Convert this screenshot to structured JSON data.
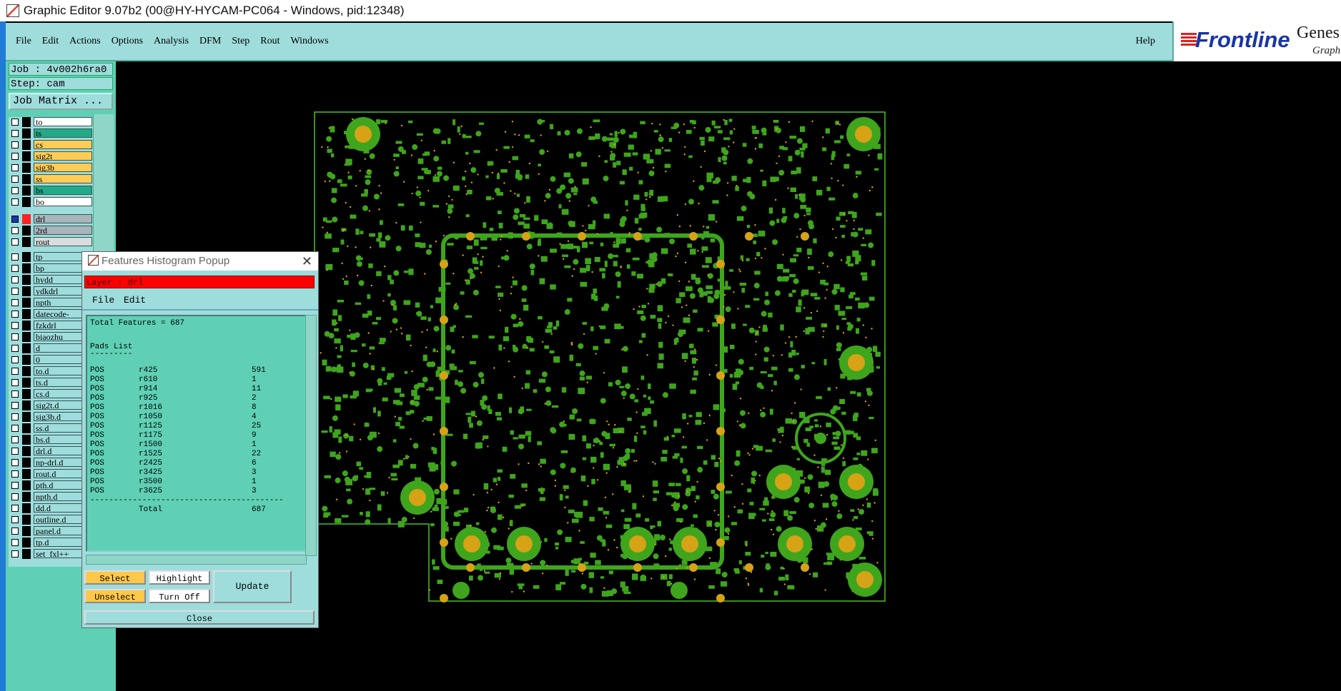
{
  "window": {
    "title": "Graphic Editor 9.07b2 (00@HY-HYCAM-PC064 - Windows, pid:12348)"
  },
  "menubar": {
    "items": [
      "File",
      "Edit",
      "Actions",
      "Options",
      "Analysis",
      "DFM",
      "Step",
      "Rout",
      "Windows"
    ],
    "help": "Help"
  },
  "logo": {
    "brand": "Frontline",
    "product": "Genes",
    "sub": "Graphi"
  },
  "side": {
    "job": "Job : 4v002h6ra0",
    "step": "Step: cam",
    "job_matrix": "Job Matrix ...",
    "layers": [
      {
        "name": "to",
        "color": "#ffffff"
      },
      {
        "name": "ts",
        "color": "#22aa88"
      },
      {
        "name": "cs",
        "color": "#ffcc55"
      },
      {
        "name": "sig2t",
        "color": "#ffcc55"
      },
      {
        "name": "sig3b",
        "color": "#ffcc55"
      },
      {
        "name": "ss",
        "color": "#ffcc55"
      },
      {
        "name": "bs",
        "color": "#22aa88"
      },
      {
        "name": "bo",
        "color": "#ffffff"
      },
      {
        "name": "drl",
        "color": "#a9b4bb"
      },
      {
        "name": "2rd",
        "color": "#a9b4bb"
      },
      {
        "name": "rout",
        "color": "#d8dddd"
      },
      {
        "name": "tp",
        "color": "#9fdcdc"
      },
      {
        "name": "bp",
        "color": "#9fdcdc"
      },
      {
        "name": "hydd",
        "color": "#9fdcdc"
      },
      {
        "name": "ydkdrl",
        "color": "#9fdcdc"
      },
      {
        "name": "npth",
        "color": "#9fdcdc"
      },
      {
        "name": "datecode-",
        "color": "#9fdcdc"
      },
      {
        "name": "fzkdrl",
        "color": "#9fdcdc"
      },
      {
        "name": "biaozhu",
        "color": "#9fdcdc"
      },
      {
        "name": "d",
        "color": "#9fdcdc"
      },
      {
        "name": "0",
        "color": "#9fdcdc"
      },
      {
        "name": "to.d",
        "color": "#9fdcdc"
      },
      {
        "name": "ts.d",
        "color": "#9fdcdc"
      },
      {
        "name": "cs.d",
        "color": "#9fdcdc"
      },
      {
        "name": "sig2t.d",
        "color": "#9fdcdc"
      },
      {
        "name": "sig3b.d",
        "color": "#9fdcdc"
      },
      {
        "name": "ss.d",
        "color": "#9fdcdc"
      },
      {
        "name": "bs.d",
        "color": "#9fdcdc"
      },
      {
        "name": "drl.d",
        "color": "#9fdcdc"
      },
      {
        "name": "np-drl.d",
        "color": "#9fdcdc"
      },
      {
        "name": "rout.d",
        "color": "#9fdcdc"
      },
      {
        "name": "pth.d",
        "color": "#9fdcdc"
      },
      {
        "name": "npth.d",
        "color": "#9fdcdc"
      },
      {
        "name": "dd.d",
        "color": "#9fdcdc"
      },
      {
        "name": "outline.d",
        "color": "#9fdcdc"
      },
      {
        "name": "panel.d",
        "color": "#9fdcdc"
      },
      {
        "name": "tp.d",
        "color": "#9fdcdc"
      },
      {
        "name": "set_fxl++",
        "color": "#9fdcdc"
      }
    ]
  },
  "popup": {
    "title": "Features Histogram Popup",
    "layer": "Layer :  drl",
    "menu": [
      "File",
      "Edit"
    ],
    "total_features": "Total Features = 687",
    "pads_heading": "Pads List",
    "pads_underline": "---------",
    "rows": [
      [
        "POS",
        "r425",
        "591"
      ],
      [
        "POS",
        "r610",
        "1"
      ],
      [
        "POS",
        "r914",
        "11"
      ],
      [
        "POS",
        "r925",
        "2"
      ],
      [
        "POS",
        "r1016",
        "8"
      ],
      [
        "POS",
        "r1050",
        "4"
      ],
      [
        "POS",
        "r1125",
        "25"
      ],
      [
        "POS",
        "r1175",
        "9"
      ],
      [
        "POS",
        "r1500",
        "1"
      ],
      [
        "POS",
        "r1525",
        "22"
      ],
      [
        "POS",
        "r2425",
        "6"
      ],
      [
        "POS",
        "r3425",
        "3"
      ],
      [
        "POS",
        "r3500",
        "1"
      ],
      [
        "POS",
        "r3625",
        "3"
      ]
    ],
    "separator": "-----------------------------------------",
    "total_label": "Total",
    "total_value": "687",
    "buttons": {
      "select": "Select",
      "highlight": "Highlight",
      "unselect": "Unselect",
      "turn_off": "Turn Off",
      "update": "Update",
      "close": "Close"
    }
  },
  "colors": {
    "board_outline": "#4cbf2c",
    "pad": "#3fa51c",
    "drill": "#d6a316",
    "menubar": "#9fdcdc",
    "panel": "#5fd0b5"
  }
}
